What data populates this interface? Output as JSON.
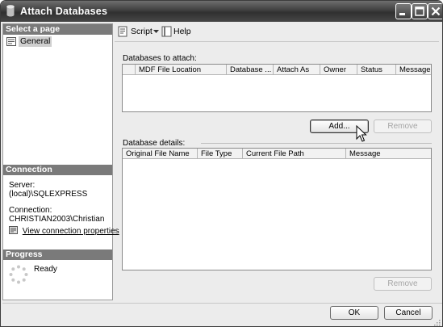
{
  "window": {
    "title": "Attach Databases"
  },
  "sidebar": {
    "pages_header": "Select a page",
    "pages": [
      {
        "label": "General"
      }
    ],
    "connection_header": "Connection",
    "server_label": "Server:",
    "server_value": "(local)\\SQLEXPRESS",
    "connection_label": "Connection:",
    "connection_value": "CHRISTIAN2003\\Christian",
    "view_link": "View connection properties",
    "progress_header": "Progress",
    "progress_status": "Ready"
  },
  "toolbar": {
    "script_label": "Script",
    "help_label": "Help"
  },
  "attach": {
    "label": "Databases to attach:",
    "columns": [
      "MDF File Location",
      "Database ...",
      "Attach As",
      "Owner",
      "Status",
      "Message"
    ],
    "add_button": "Add...",
    "remove_button": "Remove"
  },
  "details": {
    "label": "Database details:",
    "columns": [
      "Original File Name",
      "File Type",
      "Current File Path",
      "Message"
    ],
    "remove_button": "Remove"
  },
  "footer": {
    "ok_button": "OK",
    "cancel_button": "Cancel"
  }
}
